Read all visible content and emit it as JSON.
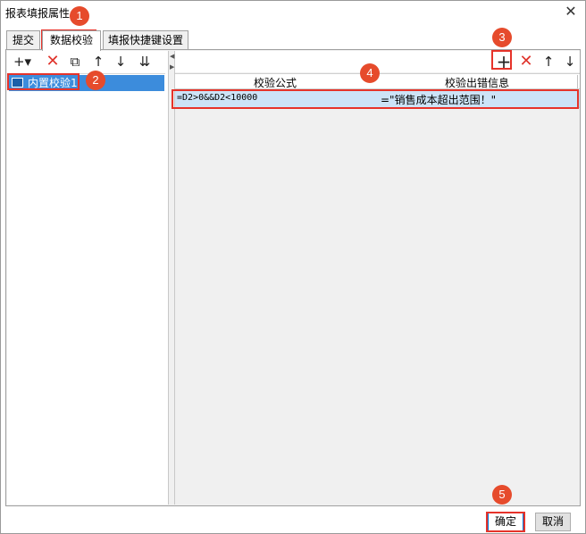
{
  "window": {
    "title": "报表填报属性",
    "close_icon": "close-icon",
    "close_glyph": "✕"
  },
  "tabs": [
    {
      "label": "提交",
      "active": false
    },
    {
      "label": "数据校验",
      "active": true
    },
    {
      "label": "填报快捷键设置",
      "active": false
    }
  ],
  "left_toolbar": [
    {
      "name": "add-icon",
      "glyph": "+▾"
    },
    {
      "name": "delete-icon",
      "glyph": "✕"
    },
    {
      "name": "copy-icon",
      "glyph": "⧉"
    },
    {
      "name": "move-up-icon",
      "glyph": "↑"
    },
    {
      "name": "move-down-icon",
      "glyph": "↓"
    },
    {
      "name": "move-bottom-icon",
      "glyph": "⇊"
    }
  ],
  "tree": {
    "items": [
      {
        "label": "内置校验1",
        "selected": true
      }
    ]
  },
  "right_toolbar": [
    {
      "name": "add-icon",
      "glyph": "+"
    },
    {
      "name": "delete-icon",
      "glyph": "✕"
    },
    {
      "name": "move-up-icon",
      "glyph": "↑"
    },
    {
      "name": "move-down-icon",
      "glyph": "↓"
    }
  ],
  "table": {
    "columns": [
      "校验公式",
      "校验出错信息"
    ],
    "rows": [
      {
        "formula": "=D2>0&&D2<10000",
        "message": "=\"销售成本超出范围！\""
      }
    ]
  },
  "buttons": {
    "ok": "确定",
    "cancel": "取消"
  },
  "annotations": [
    "1",
    "2",
    "3",
    "4",
    "5"
  ],
  "colors": {
    "highlight": "#e6332a",
    "badge": "#e64b2c",
    "selection": "#3c8cdc",
    "row_selection": "#cce3f7"
  }
}
